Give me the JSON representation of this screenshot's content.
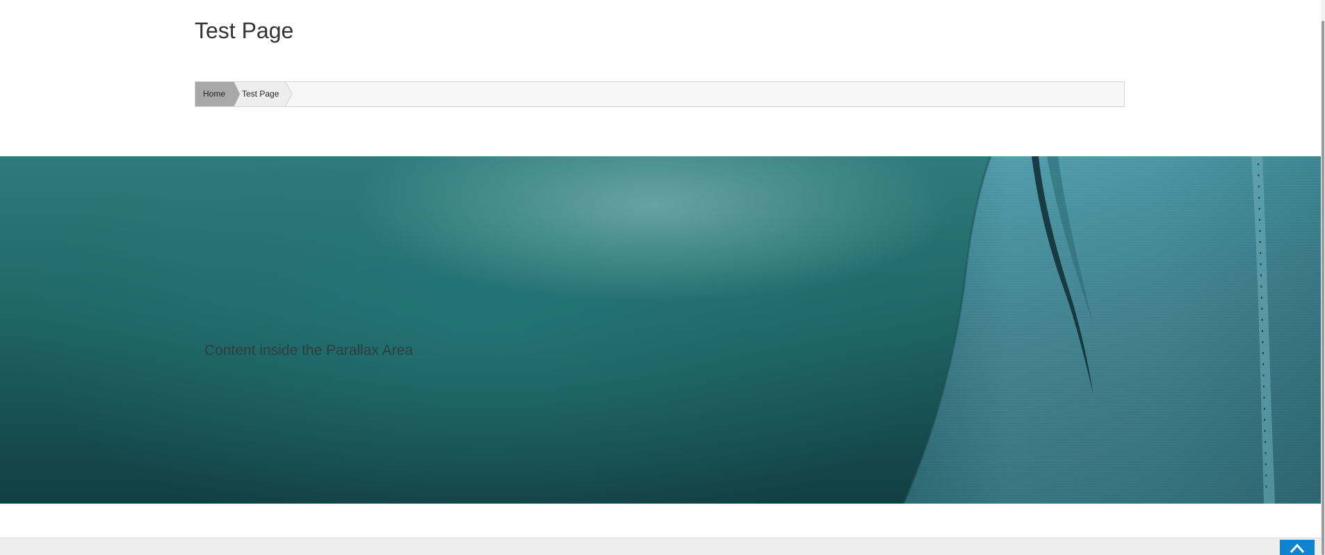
{
  "page": {
    "title": "Test Page"
  },
  "breadcrumb": {
    "items": [
      {
        "label": "Home"
      },
      {
        "label": "Test Page"
      }
    ]
  },
  "parallax": {
    "content_text": "Content inside the Parallax Area"
  },
  "scroll_top": {
    "icon": "chevron-up-icon"
  },
  "colors": {
    "accent": "#0d84d0",
    "breadcrumb_home_bg": "#a8a8a8",
    "breadcrumb_current_bg": "#eeeeee",
    "parallax_teal": "#1f6667",
    "fabric_blue": "#4e97a5"
  }
}
